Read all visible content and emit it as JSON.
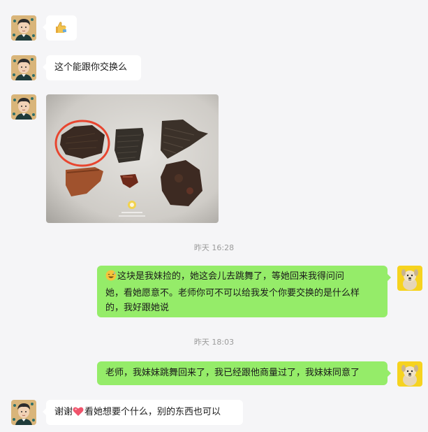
{
  "messages": [
    {
      "sender": "contact",
      "type": "emoji",
      "emoji": "thumbs-up"
    },
    {
      "sender": "contact",
      "type": "text",
      "text": "这个能跟你交换么"
    },
    {
      "sender": "contact",
      "type": "image",
      "image": "pottery-shards-photo"
    },
    {
      "type": "timestamp",
      "text": "昨天 16:28"
    },
    {
      "sender": "me",
      "type": "text",
      "emoji": "grinning-sweat-face",
      "line1": "这块是我妹捡的，她这会儿去跳舞了，等她回来我得问问",
      "line2": "她，看她愿意不。老师你可不可以给我发个你要交换的是什么样",
      "line3": "的，我好跟她说"
    },
    {
      "type": "timestamp",
      "text": "昨天 18:03"
    },
    {
      "sender": "me",
      "type": "text",
      "text": "老师，我妹妹跳舞回来了，我已经跟他商量过了，我妹妹同意了"
    },
    {
      "sender": "contact",
      "type": "text",
      "emoji": "heart",
      "before": "谢谢",
      "after": "看她想要个什么，别的东西也可以"
    }
  ],
  "colors": {
    "background": "#f5f5f7",
    "bubble_left": "#ffffff",
    "bubble_right": "#95ec69",
    "timestamp": "#9b9b9b",
    "highlight_circle": "#e8452f"
  },
  "icons": {
    "contact_avatar": "illustrated-man-avatar",
    "my_avatar": "cartoon-dog-avatar",
    "thumbs_up": "thumbs-up-emoji",
    "sweat_smile": "grinning-sweat-face-emoji",
    "heart": "heart-emoji"
  }
}
